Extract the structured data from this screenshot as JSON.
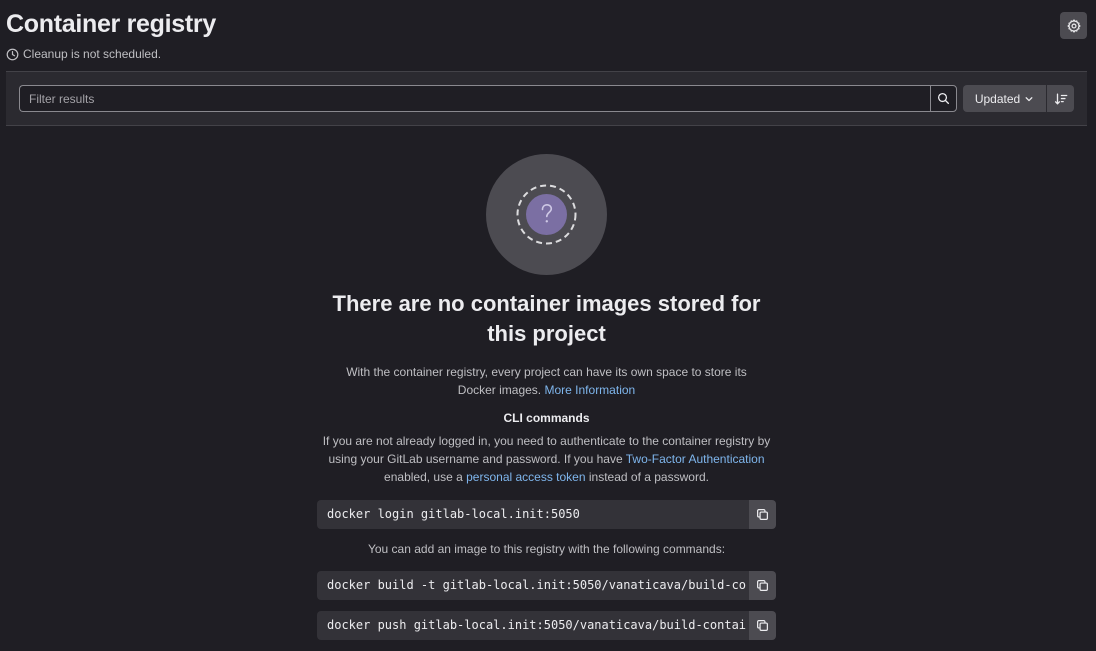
{
  "header": {
    "title": "Container registry",
    "cleanup_status": "Cleanup is not scheduled."
  },
  "filter": {
    "placeholder": "Filter results",
    "sort_label": "Updated"
  },
  "empty_state": {
    "heading": "There are no container images stored for this project",
    "description": "With the container registry, every project can have its own space to store its Docker images.",
    "more_info_link": "More Information",
    "cli_title": "CLI commands",
    "auth_text_1": "If you are not already logged in, you need to authenticate to the container registry by using your GitLab username and password. If you have",
    "two_factor_link": "Two-Factor Authentication",
    "auth_text_2": "enabled, use a",
    "pat_link": "personal access token",
    "auth_text_3": "instead of a password.",
    "login_command": "docker login gitlab-local.init:5050",
    "add_image_text": "You can add an image to this registry with the following commands:",
    "build_command": "docker build -t gitlab-local.init:5050/vanaticava/build-co",
    "push_command": "docker push gitlab-local.init:5050/vanaticava/build-contai"
  },
  "icons": {
    "settings": "gear-icon",
    "clock": "clock-icon",
    "search": "search-icon",
    "chevron": "chevron-down-icon",
    "sort": "sort-direction-icon",
    "copy": "copy-icon",
    "illustration": "question-mark-illustration"
  },
  "colors": {
    "background": "#1f1e24",
    "link": "#7fb6ed",
    "button": "#4c4b51",
    "illustration_accent": "#7b6fa3"
  }
}
